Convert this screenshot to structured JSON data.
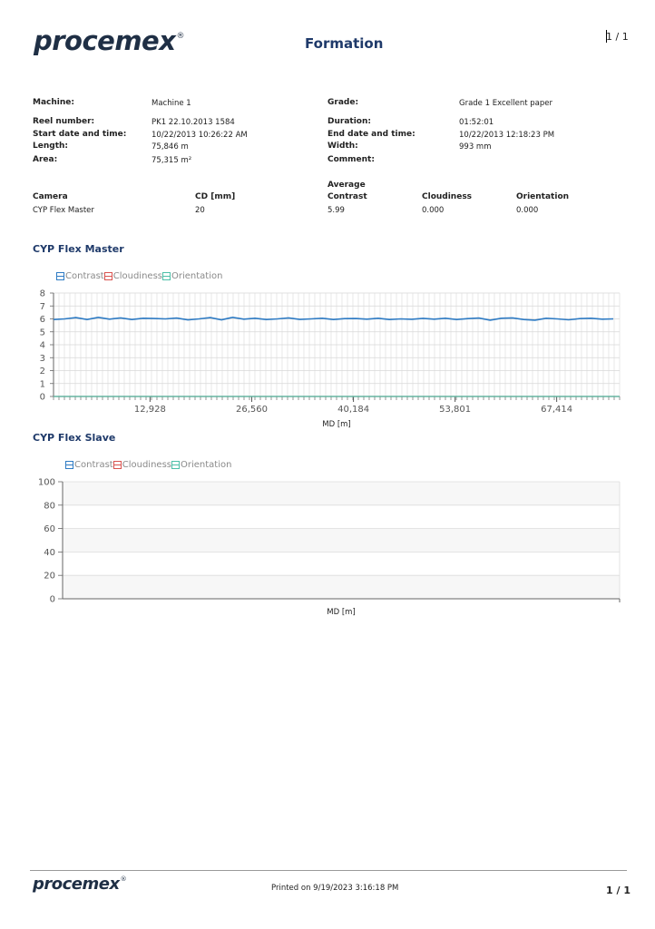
{
  "header": {
    "logo_text": "procemex",
    "logo_mark": "®",
    "title": "Formation",
    "page_indicator": "1 / 1"
  },
  "info_left": [
    {
      "label": "Machine:",
      "value": "Machine 1"
    },
    {
      "label": "Reel number:",
      "value": "PK1 22.10.2013 1584"
    },
    {
      "label": "Start date and time:",
      "value": "10/22/2013 10:26:22 AM"
    },
    {
      "label": "Length:",
      "value": "75,846 m"
    },
    {
      "label": "Area:",
      "value": "75,315 m²"
    }
  ],
  "info_right": [
    {
      "label": "Grade:",
      "value": "Grade 1 Excellent paper"
    },
    {
      "label": "Duration:",
      "value": "01:52:01"
    },
    {
      "label": "End date and time:",
      "value": "10/22/2013 12:18:23 PM"
    },
    {
      "label": "Width:",
      "value": "993 mm"
    },
    {
      "label": "Comment:",
      "value": ""
    }
  ],
  "camera_table": {
    "average_label": "Average",
    "headers": [
      "Camera",
      "CD [mm]",
      "Contrast",
      "Cloudiness",
      "Orientation"
    ],
    "rows": [
      [
        "CYP Flex Master",
        "20",
        "5.99",
        "0.000",
        "0.000"
      ]
    ]
  },
  "legend": [
    {
      "name": "Contrast",
      "color": "#2e7bc4"
    },
    {
      "name": "Cloudiness",
      "color": "#d9534f"
    },
    {
      "name": "Orientation",
      "color": "#4dbfa8"
    }
  ],
  "chart_data": [
    {
      "type": "line",
      "title": "CYP Flex Master",
      "xlabel": "MD [m]",
      "ylabel": "",
      "ylim": [
        0,
        8
      ],
      "xlim": [
        0,
        75846
      ],
      "yticks": [
        0,
        1,
        2,
        3,
        4,
        5,
        6,
        7,
        8
      ],
      "xticks": [
        "12,928",
        "26,560",
        "40,184",
        "53,801",
        "67,414"
      ],
      "xtick_values": [
        12928,
        26560,
        40184,
        53801,
        67414
      ],
      "grid": true,
      "legend_position": "top-left",
      "series": [
        {
          "name": "Contrast",
          "color": "#2e7bc4",
          "x": [
            0,
            1500,
            3000,
            4500,
            6000,
            7500,
            9000,
            10500,
            12000,
            13500,
            15000,
            16500,
            18000,
            19500,
            21000,
            22500,
            24000,
            25500,
            27000,
            28500,
            30000,
            31500,
            33000,
            34500,
            36000,
            37500,
            39000,
            40500,
            42000,
            43500,
            45000,
            46500,
            48000,
            49500,
            51000,
            52500,
            54000,
            55500,
            57000,
            58500,
            60000,
            61500,
            63000,
            64500,
            66000,
            67500,
            69000,
            70500,
            72000,
            73500,
            75000
          ],
          "values": [
            5.95,
            6.0,
            6.1,
            5.95,
            6.12,
            5.98,
            6.08,
            5.95,
            6.05,
            6.03,
            6.0,
            6.06,
            5.92,
            6.0,
            6.1,
            5.93,
            6.12,
            5.98,
            6.05,
            5.95,
            6.0,
            6.08,
            5.96,
            6.0,
            6.05,
            5.95,
            6.02,
            6.03,
            5.98,
            6.05,
            5.95,
            6.0,
            5.97,
            6.04,
            5.98,
            6.05,
            5.95,
            6.02,
            6.06,
            5.9,
            6.05,
            6.08,
            5.95,
            5.9,
            6.05,
            6.0,
            5.93,
            6.02,
            6.05,
            5.98,
            6.0
          ]
        },
        {
          "name": "Cloudiness",
          "color": "#d9534f",
          "x": [
            0,
            75846
          ],
          "values": [
            0,
            0
          ]
        },
        {
          "name": "Orientation",
          "color": "#4dbfa8",
          "x": [
            0,
            75846
          ],
          "values": [
            0,
            0
          ]
        }
      ]
    },
    {
      "type": "line",
      "title": "CYP Flex Slave",
      "xlabel": "MD [m]",
      "ylabel": "",
      "ylim": [
        0,
        100
      ],
      "yticks": [
        0,
        20,
        40,
        60,
        80,
        100
      ],
      "grid": true,
      "legend_position": "top-left",
      "series": []
    }
  ],
  "footer": {
    "logo_text": "procemex",
    "logo_mark": "®",
    "printed": "Printed on 9/19/2023 3:16:18 PM",
    "page_indicator": "1 / 1"
  }
}
